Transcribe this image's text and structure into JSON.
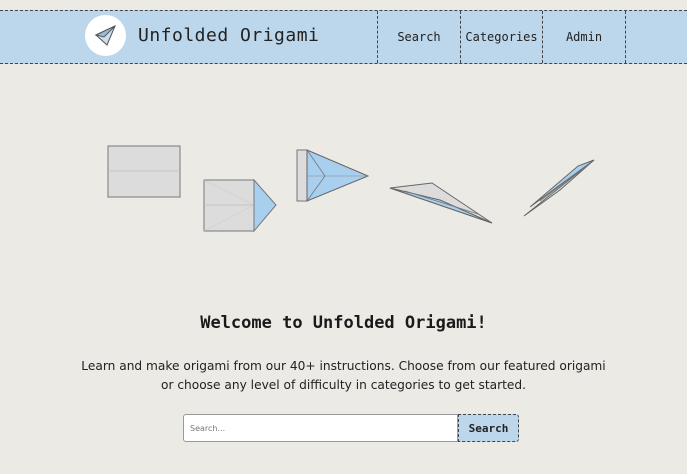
{
  "header": {
    "brand": "Unfolded Origami",
    "logo_icon": "paper-plane-icon",
    "nav": {
      "search": "Search",
      "categories": "Categories",
      "admin": "Admin"
    }
  },
  "hero": {
    "illustration": "paper-plane-folding-steps"
  },
  "main": {
    "welcome": "Welcome to Unfolded Origami!",
    "intro": "Learn and make origami from our 40+ instructions. Choose from our featured origami or choose any level of difficulty in categories to get started.",
    "search_placeholder": "Search...",
    "search_button": "Search"
  },
  "colors": {
    "nav_bg": "#bcd7ec",
    "page_bg": "#eceae5",
    "accent_blue": "#a9cfee",
    "paper_gray": "#dcdcdc"
  }
}
